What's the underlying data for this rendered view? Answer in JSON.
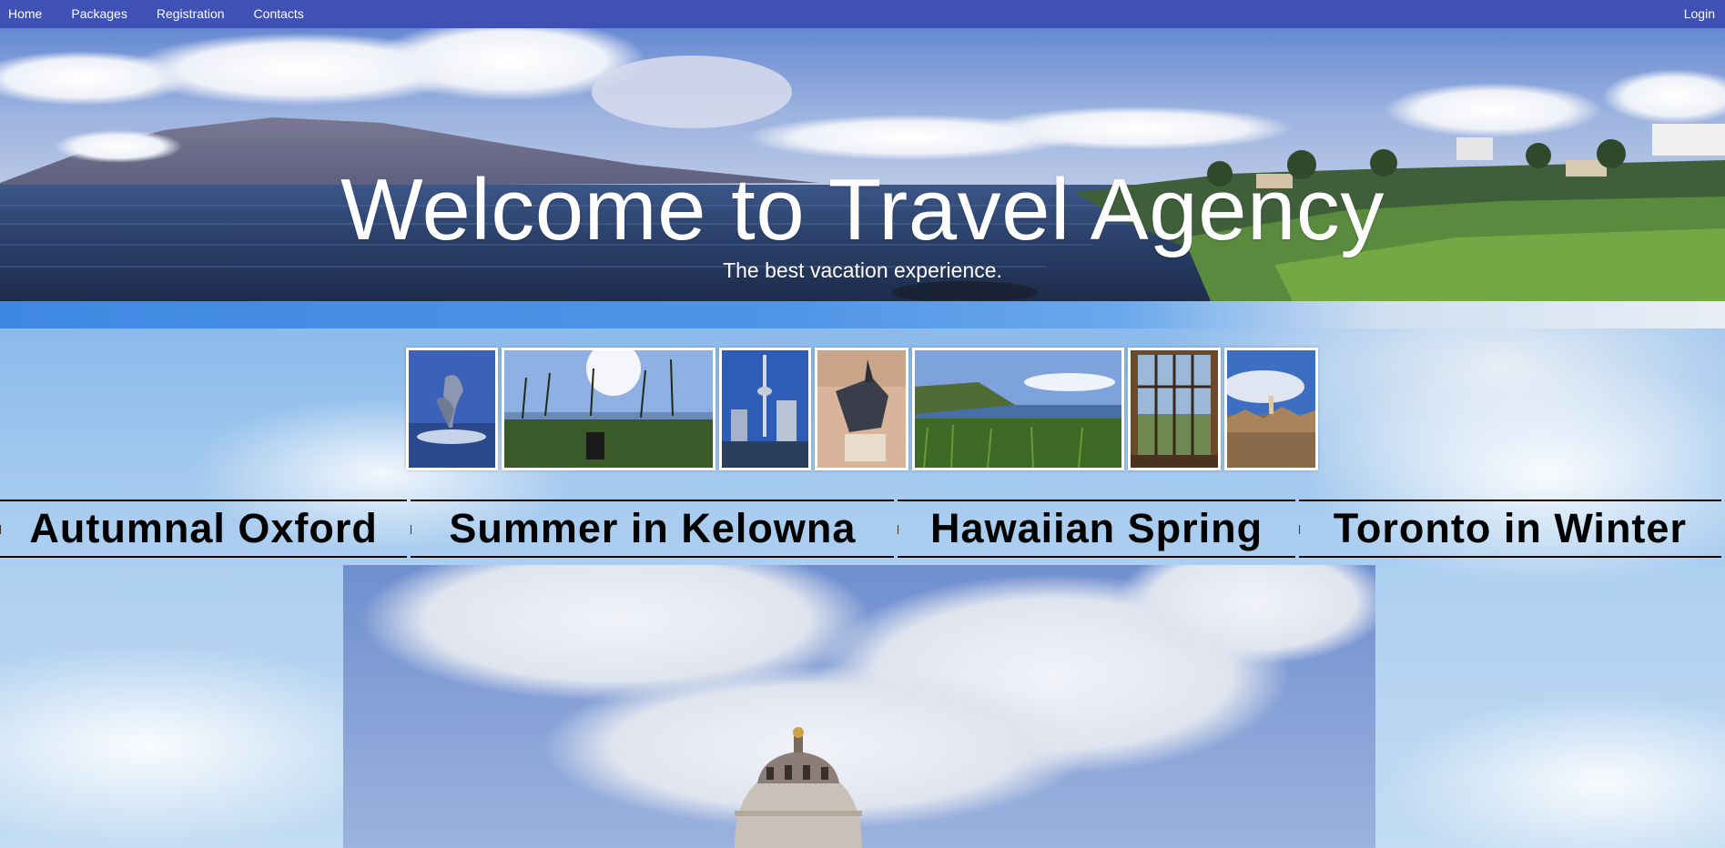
{
  "nav": {
    "items": [
      {
        "label": "Home"
      },
      {
        "label": "Packages"
      },
      {
        "label": "Registration"
      },
      {
        "label": "Contacts"
      }
    ],
    "login_label": "Login",
    "bg_color": "#3f51b5"
  },
  "hero": {
    "title": "Welcome to Travel Agency",
    "subtitle": "The best vacation experience."
  },
  "gallery": {
    "thumbnails": [
      {
        "subject": "dolphin fountain"
      },
      {
        "subject": "palm trees on lawn by the sea"
      },
      {
        "subject": "city tower skyline from harbor"
      },
      {
        "subject": "dinosaur skull exhibit"
      },
      {
        "subject": "coastal cliff with grass and ocean"
      },
      {
        "subject": "tall window with garden view"
      },
      {
        "subject": "old town rooftops"
      }
    ]
  },
  "packages": {
    "tabs": [
      {
        "label": "Autumnal Oxford"
      },
      {
        "label": "Summer in Kelowna"
      },
      {
        "label": "Hawaiian Spring"
      },
      {
        "label": "Toronto in Winter"
      }
    ]
  },
  "feature": {
    "subject": "domed building against cloudy sky"
  }
}
